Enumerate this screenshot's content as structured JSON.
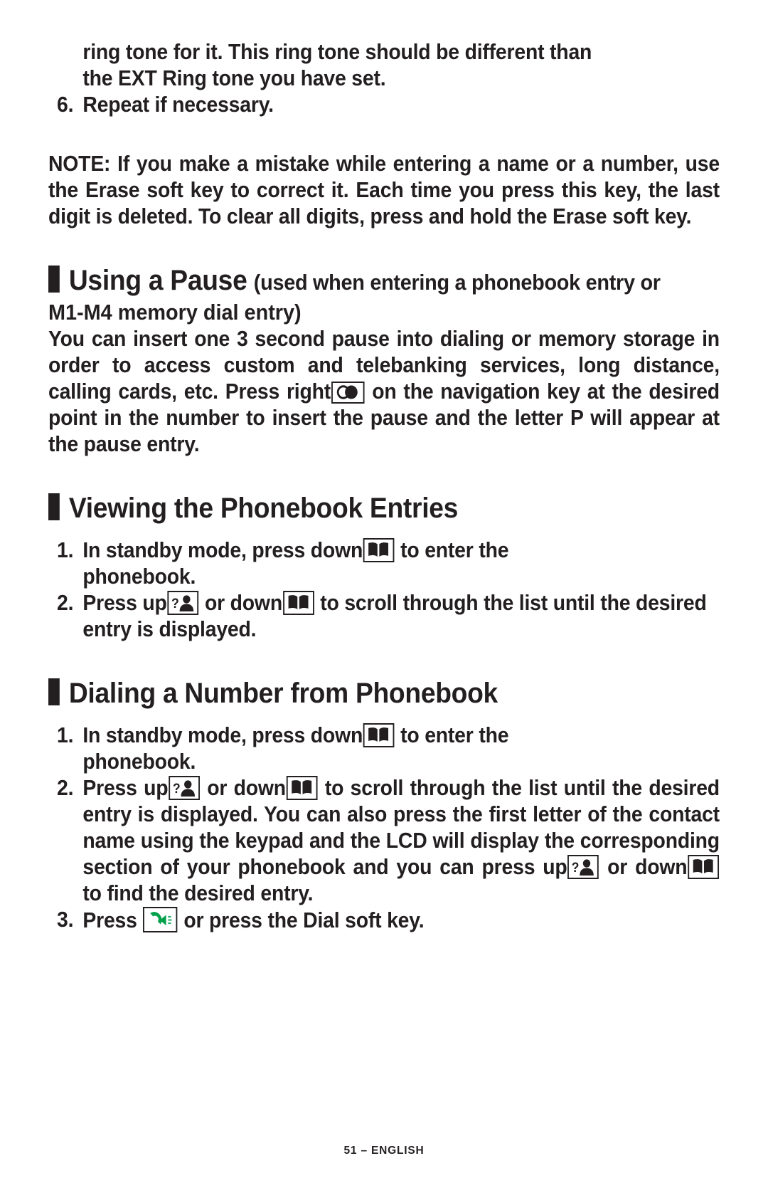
{
  "document": {
    "page_label": "51 – ENGLISH",
    "colors": {
      "text": "#231f20",
      "phone_icon_green": "#00a14b",
      "page_background": "#ffffff"
    }
  },
  "continued_item": {
    "line1": "ring tone for it.  This ring tone should be different than",
    "line2": "the EXT Ring tone you have set."
  },
  "step6": {
    "number": "6.",
    "text": "Repeat if necessary."
  },
  "note": {
    "label": "NOTE:",
    "t1": " If you make a mistake while entering a name or a number, use the ",
    "erase1": "Erase",
    "t2": " soft key to correct it.  Each time you press this key, the last digit is deleted.  To clear all digits, press and hold the ",
    "erase2": "Erase",
    "t3": " soft key."
  },
  "section_pause": {
    "title": "Using a Pause",
    "subtitle": "(used when entering a phonebook entry or",
    "subtitle_cont": "M1-M4 memory dial entry)",
    "body_1": "You can insert one 3 second pause into dialing or memory storage in order to access custom and telebanking services, long distance, calling cards, etc.   Press right",
    "nav_icon": "navigation-right-icon",
    "body_2": " on the navigation key at the desired point in the number to insert the pause and the letter ",
    "letter_p": "P",
    "body_3": " will appear at the pause entry."
  },
  "section_viewing": {
    "title": "Viewing the Phonebook Entries",
    "steps": [
      {
        "number": "1.",
        "text_a": "In  standby  mode,  press  down",
        "icon": "phonebook-book-icon",
        "text_b": "to  enter  the",
        "text_c": "phonebook."
      },
      {
        "number": "2.",
        "text_a": "Press up",
        "icon_a": "caller-id-person-icon",
        "text_b": " or down",
        "icon_b": "phonebook-book-icon",
        "text_c": " to scroll through the list until the desired entry is displayed."
      }
    ]
  },
  "section_dialing": {
    "title": "Dialing a Number from Phonebook",
    "steps": [
      {
        "number": "1.",
        "text_a": "In  standby  mode,  press  down",
        "icon": "phonebook-book-icon",
        "text_b": "to  enter  the",
        "text_c": "phonebook."
      },
      {
        "number": "2.",
        "text_a": "Press up",
        "icon_a": "caller-id-person-icon",
        "text_b": " or down",
        "icon_b": "phonebook-book-icon",
        "text_c": " to scroll through the list until the desired entry is displayed.  You can also press the first letter of the contact name using the keypad and the LCD will display the corresponding section of your phonebook and you can press up",
        "icon_c": "caller-id-person-icon",
        "text_d": " or down",
        "icon_d": "phonebook-book-icon",
        "text_e": " to find the desired entry."
      },
      {
        "number": "3.",
        "text_a": "Press ",
        "icon": "green-phone-talk-icon",
        "text_b": " or press the ",
        "dial": "Dial",
        "text_c": " soft key."
      }
    ]
  }
}
